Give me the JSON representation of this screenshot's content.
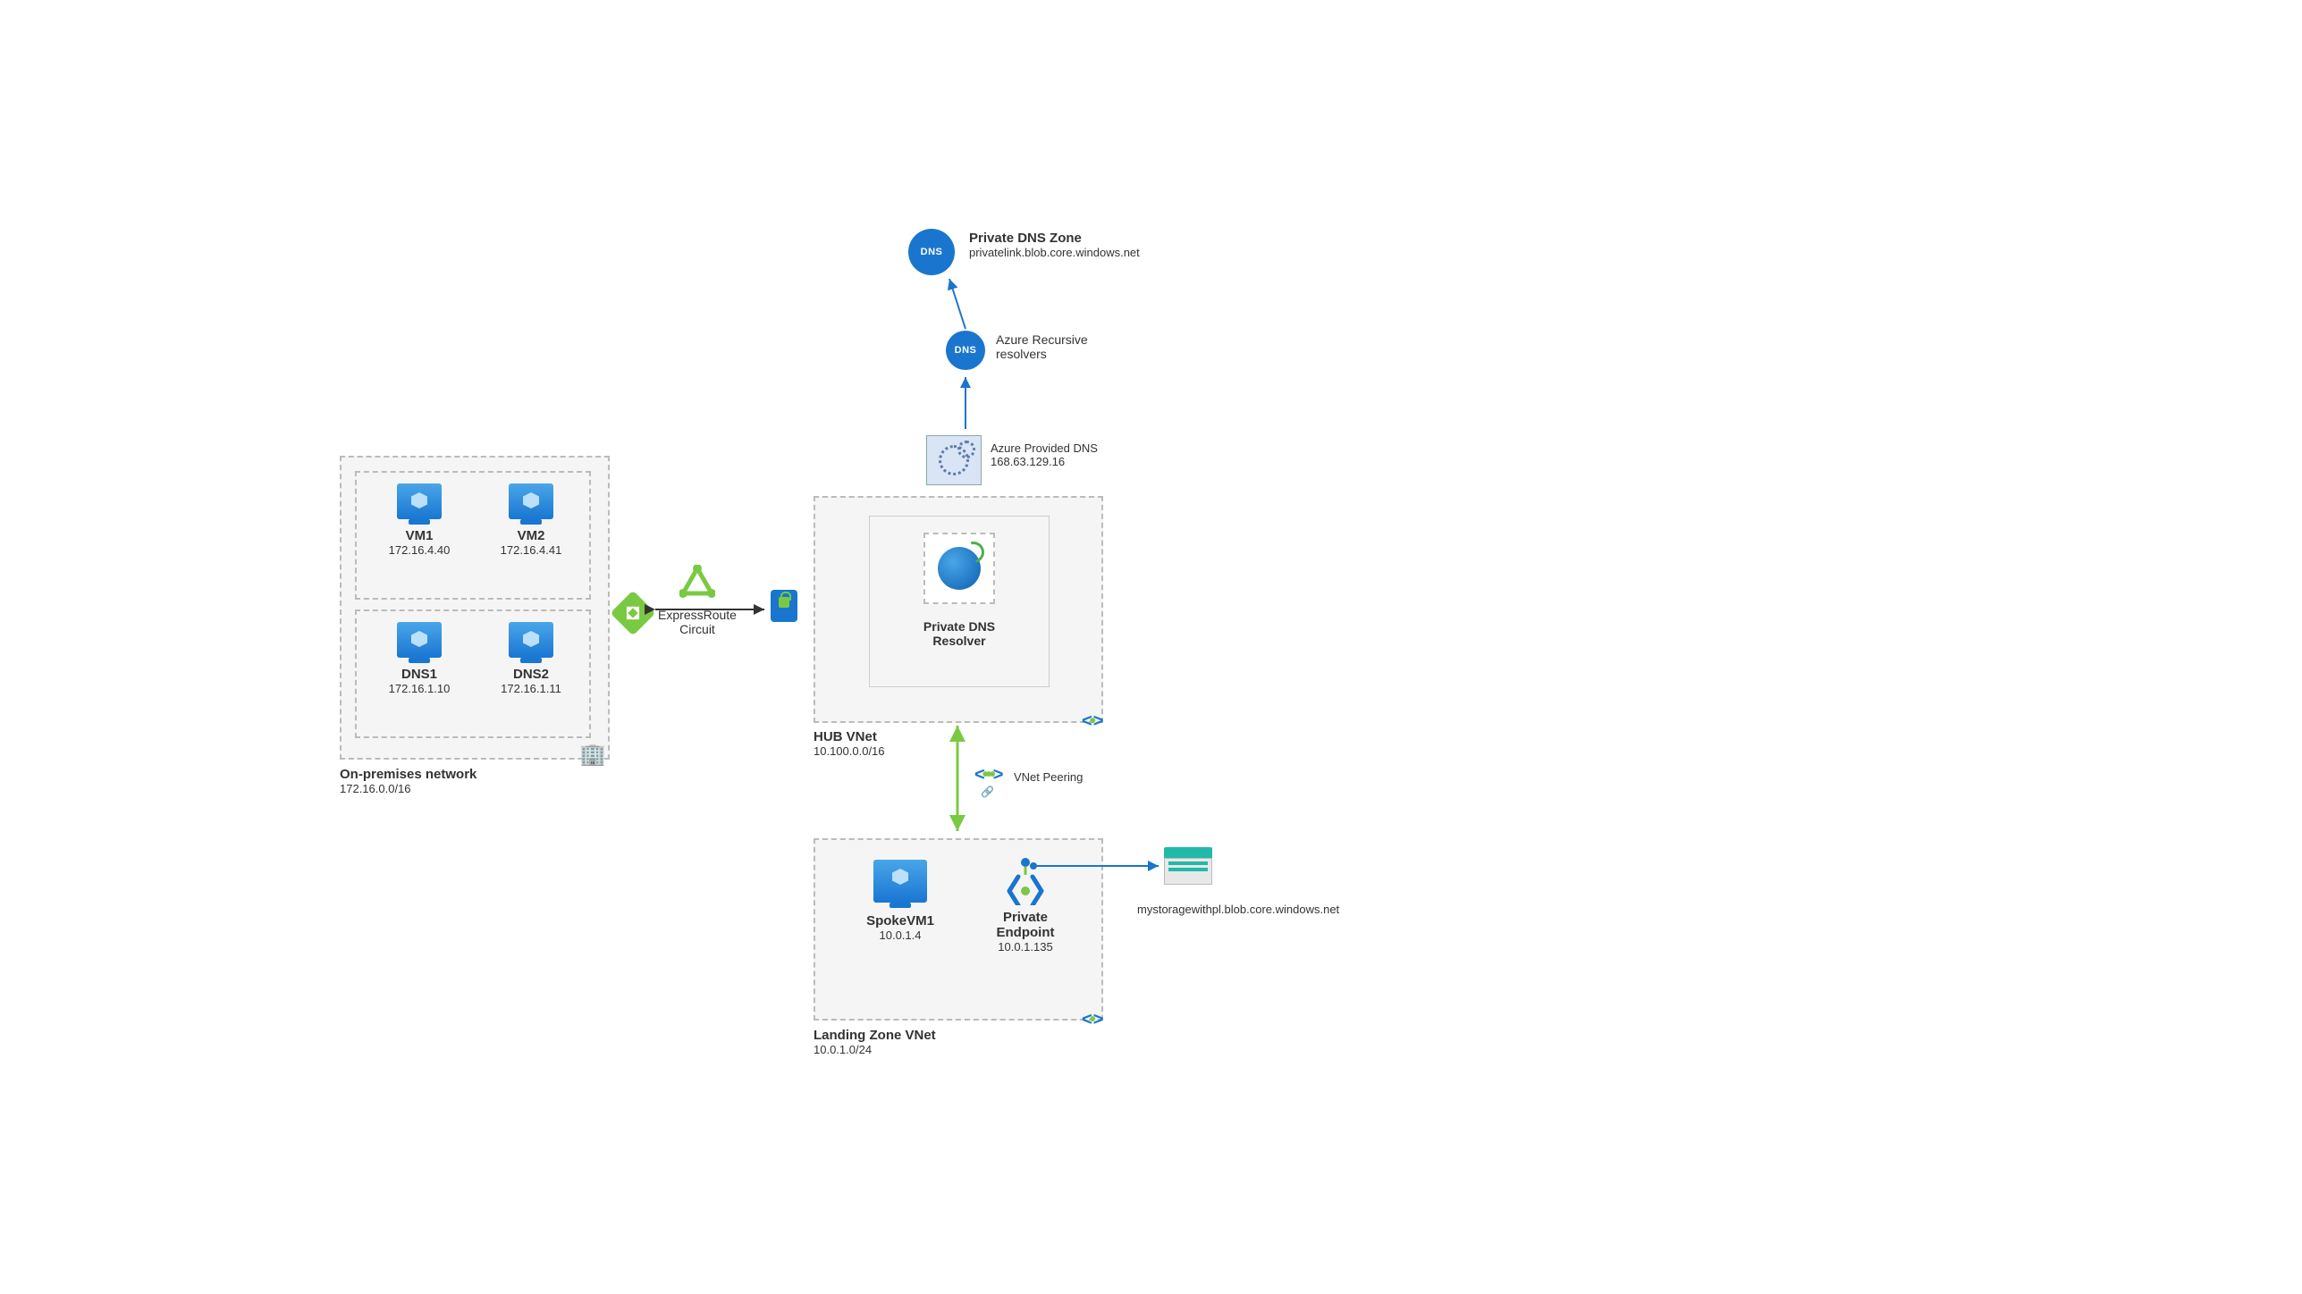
{
  "onprem": {
    "title": "On-premises network",
    "cidr": "172.16.0.0/16",
    "vm1": {
      "name": "VM1",
      "ip": "172.16.4.40"
    },
    "vm2": {
      "name": "VM2",
      "ip": "172.16.4.41"
    },
    "dns1": {
      "name": "DNS1",
      "ip": "172.16.1.10"
    },
    "dns2": {
      "name": "DNS2",
      "ip": "172.16.1.11"
    }
  },
  "expressroute": {
    "label": "ExpressRoute\nCircuit"
  },
  "hub": {
    "title": "HUB VNet",
    "cidr": "10.100.0.0/16",
    "resolver": "Private DNS\nResolver"
  },
  "azure_dns": {
    "title": "Azure Provided DNS",
    "ip": "168.63.129.16"
  },
  "recursive": {
    "label": "Azure Recursive\nresolvers"
  },
  "private_zone": {
    "title": "Private DNS Zone",
    "zone": "privatelink.blob.core.windows.net"
  },
  "peering": {
    "label": "VNet Peering"
  },
  "spoke": {
    "title": "Landing Zone VNet",
    "cidr": "10.0.1.0/24",
    "vm": {
      "name": "SpokeVM1",
      "ip": "10.0.1.4"
    },
    "pe": {
      "name": "Private\nEndpoint",
      "ip": "10.0.1.135"
    }
  },
  "storage": {
    "fqdn": "mystoragewithpl.blob.core.windows.net"
  }
}
